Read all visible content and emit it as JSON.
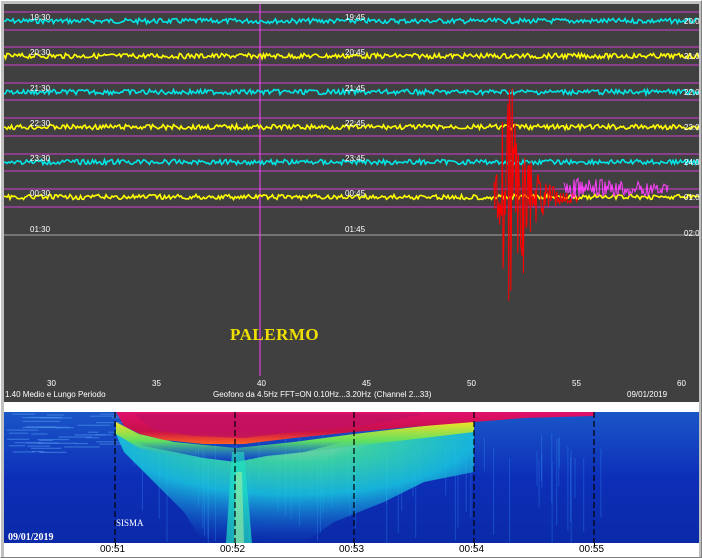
{
  "helicorder": {
    "station": "PALERMO",
    "left_times": [
      "19:30",
      "20:30",
      "21:30",
      "22:30",
      "23:30",
      "00:30",
      "01:30"
    ],
    "mid_times": [
      "19:45",
      "20:45",
      "21:45",
      "22:45",
      "23:45",
      "00:45",
      "01:45"
    ],
    "right_times": [
      "20:0",
      "21:0",
      "22:0",
      "23:0",
      "24:0",
      "01:0",
      "02:0"
    ],
    "x_ticks": [
      "30",
      "35",
      "40",
      "45",
      "50",
      "55",
      "60"
    ],
    "footer_left": "1.40  Medio e Lungo Periodo",
    "footer_center": "Geofono da 4.5Hz FFT=ON 0.10Hz...3.20Hz",
    "footer_channel": "(Channel 2...33)",
    "footer_date": "09/01/2019",
    "trace_colors": [
      "#00e5e5",
      "#ffff00",
      "#00e5e5",
      "#ffff00",
      "#00e5e5",
      "#ffff00"
    ],
    "event_color": "#ff0000",
    "marker_color": "#ff40ff"
  },
  "spectrogram": {
    "date": "09/01/2019",
    "annotation": "SISMA",
    "time_labels": [
      "00:51",
      "00:52",
      "00:53",
      "00:54",
      "00:55"
    ]
  }
}
